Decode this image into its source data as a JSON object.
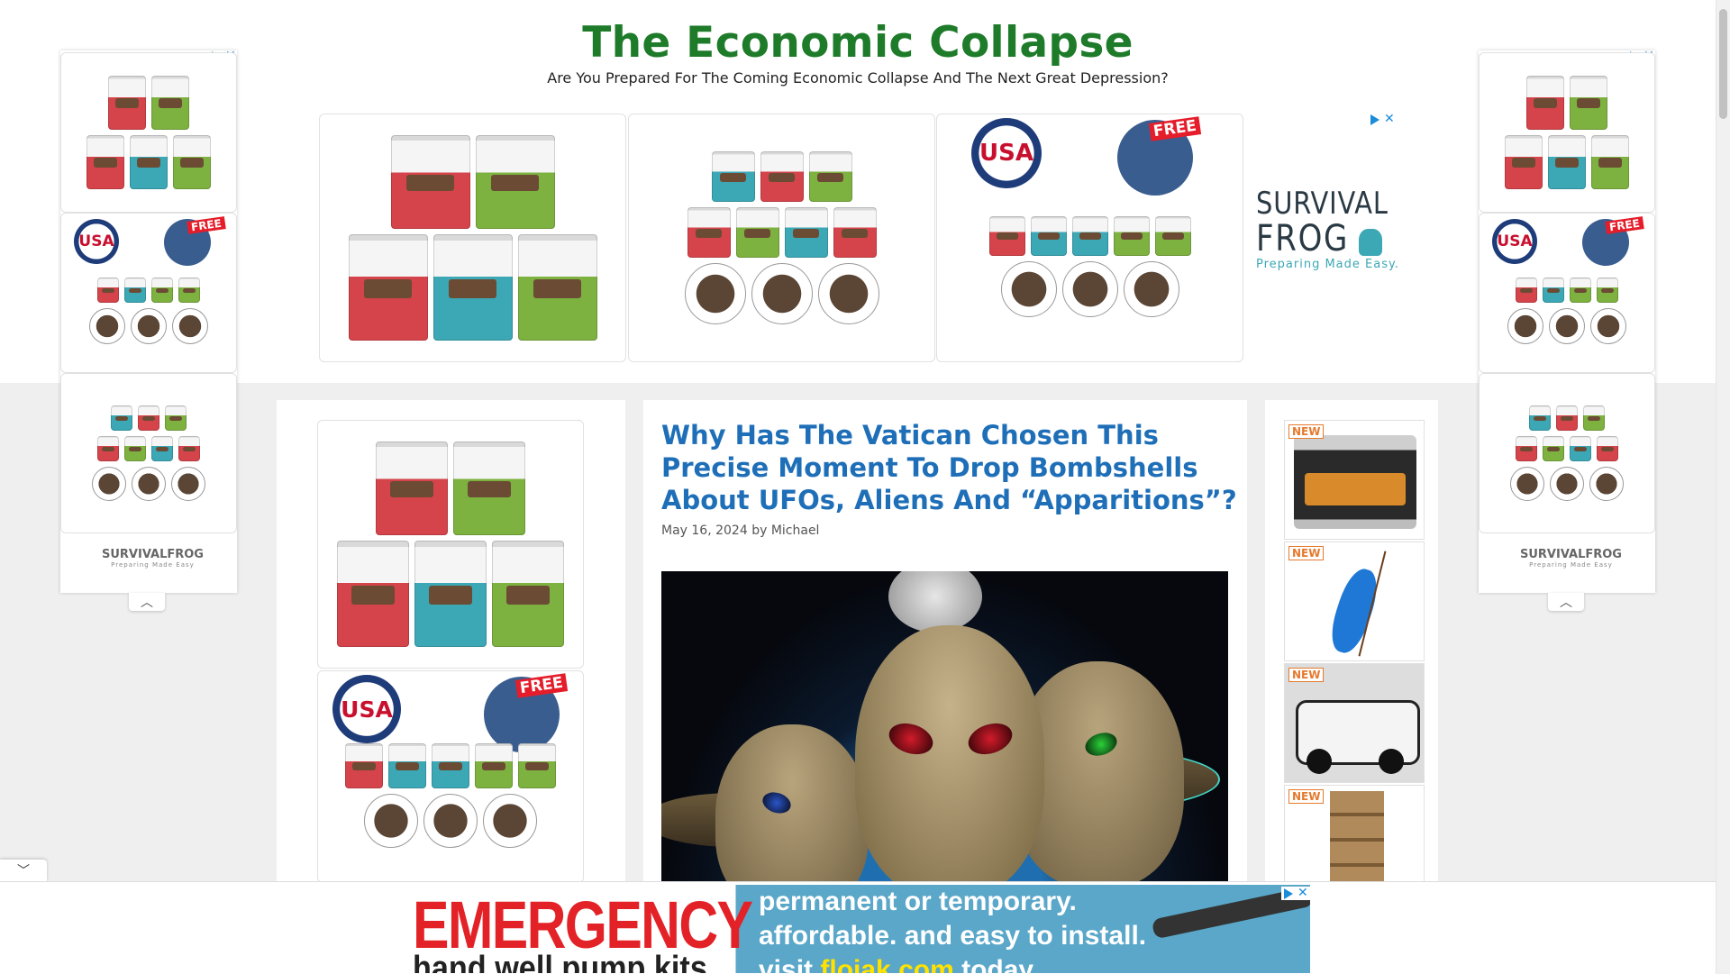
{
  "site": {
    "title": "The Economic Collapse",
    "tagline": "Are You Prepared For The Coming Economic Collapse And The Next Great Depression?"
  },
  "ads": {
    "close_glyph": "✕",
    "survival_frog": {
      "line1": "SURVIVAL",
      "line2": "FROG",
      "slogan": "Preparing Made Easy."
    },
    "rail_logo": {
      "name": "SURVIVALFROG",
      "slogan": "Preparing Made Easy"
    },
    "product_labels": {
      "free": "FREE",
      "usa": "USA"
    },
    "new_badge": "NEW",
    "bottom_banner": {
      "headline": "EMERGENCY",
      "subline": "hand well pump kits",
      "line1": "permanent or temporary.",
      "line2": "affordable. and easy to install.",
      "line3_prefix": "visit",
      "line3_site": "flojak.com",
      "line3_suffix": "today"
    }
  },
  "article": {
    "title": "Why Has The Vatican Chosen This Precise Moment To Drop Bombshells About UFOs, Aliens And “Apparitions”?",
    "date": "May 16, 2024",
    "by": "by",
    "author": "Michael"
  },
  "controls": {
    "collapse_up": "︿",
    "collapse_down": "﹀"
  }
}
